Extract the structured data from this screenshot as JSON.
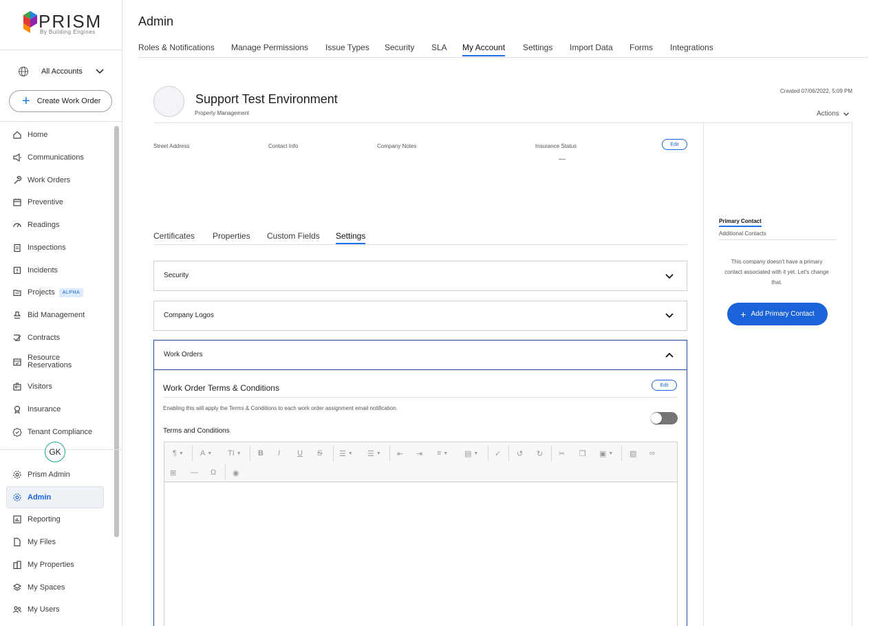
{
  "brand": {
    "name": "PRISM",
    "tagline": "By Building Engines"
  },
  "sidebar": {
    "accounts_label": "All Accounts",
    "create_label": "Create Work Order",
    "items": [
      {
        "label": "Home",
        "icon": "home-icon"
      },
      {
        "label": "Communications",
        "icon": "megaphone-icon"
      },
      {
        "label": "Work Orders",
        "icon": "wrench-icon"
      },
      {
        "label": "Preventive",
        "icon": "calendar-icon"
      },
      {
        "label": "Readings",
        "icon": "gauge-icon"
      },
      {
        "label": "Inspections",
        "icon": "clipboard-icon"
      },
      {
        "label": "Incidents",
        "icon": "alert-icon"
      },
      {
        "label": "Projects",
        "icon": "folder-icon",
        "badge": "ALPHA"
      },
      {
        "label": "Bid Management",
        "icon": "stamp-icon"
      },
      {
        "label": "Contracts",
        "icon": "contract-icon"
      },
      {
        "label": "Resource Reservations",
        "icon": "calendar-check-icon"
      },
      {
        "label": "Visitors",
        "icon": "visitor-badge-icon"
      },
      {
        "label": "Insurance",
        "icon": "shield-icon"
      },
      {
        "label": "Tenant Compliance",
        "icon": "badge-check-icon"
      }
    ],
    "user_initials": "GK",
    "bottom_items": [
      {
        "label": "Prism Admin",
        "icon": "gear-icon"
      },
      {
        "label": "Admin",
        "icon": "gear-icon",
        "active": true
      },
      {
        "label": "Reporting",
        "icon": "chart-icon"
      },
      {
        "label": "My Files",
        "icon": "file-icon"
      },
      {
        "label": "My Properties",
        "icon": "building-icon"
      },
      {
        "label": "My Spaces",
        "icon": "layers-icon"
      },
      {
        "label": "My Users",
        "icon": "users-icon"
      }
    ]
  },
  "page": {
    "title": "Admin"
  },
  "top_tabs": [
    "Roles & Notifications",
    "Manage Permissions",
    "Issue Types",
    "Security",
    "SLA",
    "My Account",
    "Settings",
    "Import Data",
    "Forms",
    "Integrations"
  ],
  "active_top_tab": "My Account",
  "company": {
    "name": "Support Test Environment",
    "type": "Property Management",
    "created": "Created 07/06/2022, 5:09 PM",
    "actions_label": "Actions",
    "info_labels": [
      "Street Address",
      "Contact Info",
      "Company Notes",
      "Insurance Status"
    ],
    "insurance_value": "—",
    "edit_label": "Edit"
  },
  "contacts": {
    "primary_tab": "Primary Contact",
    "additional_tab": "Additional Contacts",
    "empty_message": "This company doesn't have a primary contact associated with it yet. Let's change that.",
    "add_label": "Add Primary Contact"
  },
  "sub_tabs": [
    "Certificates",
    "Properties",
    "Custom Fields",
    "Settings"
  ],
  "active_sub_tab": "Settings",
  "accordions": {
    "security": "Security",
    "logos": "Company Logos",
    "work_orders": "Work Orders"
  },
  "work_orders": {
    "terms_title": "Work Order Terms & Conditions",
    "edit_label": "Edit",
    "description": "Enabling this will apply the Terms & Conditions to each work order assignment email notification.",
    "toggle_on": false,
    "terms_label": "Terms and Conditions"
  },
  "colors": {
    "accent": "#1a73e8",
    "primary_button": "#1a63d8",
    "active_accordion_border": "#1a4fa0"
  }
}
